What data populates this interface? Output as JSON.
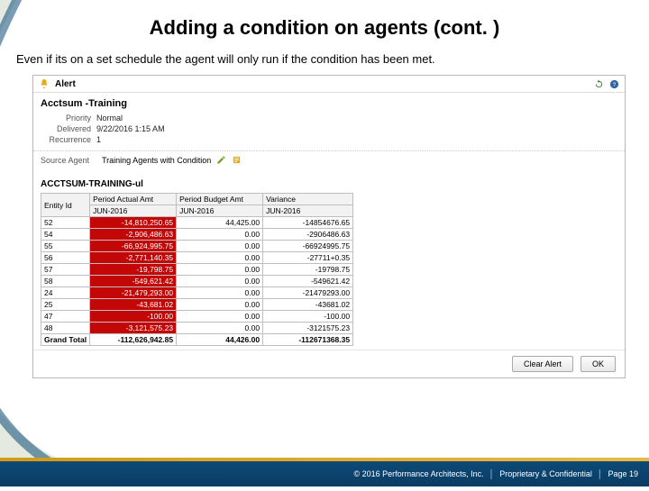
{
  "slide": {
    "title": "Adding a condition on agents (cont. )",
    "subtitle": "Even if its on a set schedule the agent will only run if the condition has been met."
  },
  "alert": {
    "barLabel": "Alert",
    "title": "Acctsum -Training",
    "priorityLabel": "Priority",
    "priorityValue": "Normal",
    "deliveredLabel": "Delivered",
    "deliveredValue": "9/22/2016 1:15 AM",
    "recurrenceLabel": "Recurrence",
    "recurrenceValue": "1",
    "sourceLabel": "Source Agent",
    "sourceValue": "Training Agents with Condition"
  },
  "report": {
    "title": "ACCTSUM-TRAINING-ul",
    "col1": "Entity Id",
    "col2a": "Period Actual Amt",
    "col2b": "JUN-2016",
    "col3a": "Period Budget Amt",
    "col3b": "JUN-2016",
    "col4a": "Variance",
    "col4b": "JUN-2016",
    "rows": [
      {
        "id": "52",
        "a": "-14,810,250.65",
        "b": "44,425.00",
        "v": "-14854676.65"
      },
      {
        "id": "54",
        "a": "-2,906,486.63",
        "b": "0.00",
        "v": "-2906486.63"
      },
      {
        "id": "55",
        "a": "-66,924,995.75",
        "b": "0.00",
        "v": "-66924995.75"
      },
      {
        "id": "56",
        "a": "-2,771,140.35",
        "b": "0.00",
        "v": "-27711+0.35"
      },
      {
        "id": "57",
        "a": "-19,798.75",
        "b": "0.00",
        "v": "-19798.75"
      },
      {
        "id": "58",
        "a": "-549,621.42",
        "b": "0.00",
        "v": "-549621.42"
      },
      {
        "id": "24",
        "a": "-21,479,293.00",
        "b": "0.00",
        "v": "-21479293.00"
      },
      {
        "id": "25",
        "a": "-43,681.02",
        "b": "0.00",
        "v": "-43681.02"
      },
      {
        "id": "47",
        "a": "-100.00",
        "b": "0.00",
        "v": "-100.00"
      },
      {
        "id": "48",
        "a": "-3,121,575.23",
        "b": "0.00",
        "v": "-3121575.23"
      }
    ],
    "grandLabel": "Grand Total",
    "grandA": "-112,626,942.85",
    "grandB": "44,426.00",
    "grandV": "-112671368.35"
  },
  "buttons": {
    "clear": "Clear Alert",
    "ok": "OK"
  },
  "footer": {
    "copyright": "© 2016 Performance Architects, Inc.",
    "proprietary": "Proprietary & Confidential",
    "page": "Page 19"
  }
}
